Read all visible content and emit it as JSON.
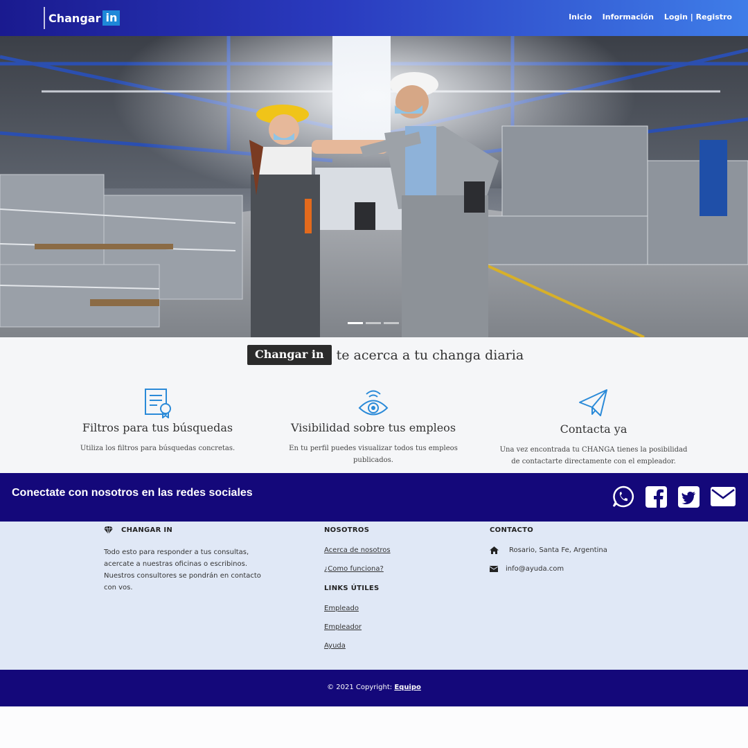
{
  "navbar": {
    "brand_text": "Changar",
    "brand_box": "in",
    "links": [
      "Inicio",
      "Información",
      "Login | Registro"
    ]
  },
  "hero": {
    "carousel_slides": 3,
    "active_slide": 1
  },
  "tagline": {
    "badge": "Changar in",
    "text": "te acerca a tu changa diaria"
  },
  "features": [
    {
      "icon": "certificate-icon",
      "title": "Filtros para tus búsquedas",
      "desc": "Utiliza los filtros para búsquedas concretas."
    },
    {
      "icon": "eye-icon",
      "title": "Visibilidad sobre tus empleos",
      "desc": "En tu perfil puedes visualizar todos tus empleos publicados."
    },
    {
      "icon": "paper-plane-icon",
      "title": "Contacta ya",
      "desc": "Una vez encontrada tu CHANGA tienes la posibilidad de contactarte directamente con el empleador."
    }
  ],
  "social": {
    "title": "Conectate con nosotros en las redes sociales",
    "icons": [
      "whatsapp-icon",
      "facebook-icon",
      "twitter-icon",
      "email-icon"
    ]
  },
  "footer": {
    "about_title": "CHANGAR IN",
    "about_text": "Todo esto para responder a tus consultas, acercate a nuestras oficinas o escribinos. Nuestros consultores se pondrán en contacto con vos.",
    "nosotros_title": "NOSOTROS",
    "nosotros_links": [
      "Acerca de nosotros",
      "¿Como funciona?"
    ],
    "links_title": "LINKS ÚTILES",
    "links": [
      "Empleado",
      "Empleador",
      "Ayuda"
    ],
    "contact_title": "CONTACTO",
    "address": "Rosario, Santa Fe, Argentina",
    "email": "info@ayuda.com"
  },
  "copyright": {
    "text": "© 2021 Copyright:",
    "link": "Equipo"
  },
  "colors": {
    "nav_start": "#1a1a8f",
    "nav_end": "#3f7de8",
    "dark_blue": "#14087a",
    "brand_box": "#1e88d8",
    "footer_bg": "#e0e8f6",
    "icon_blue": "#2a8ad8"
  }
}
